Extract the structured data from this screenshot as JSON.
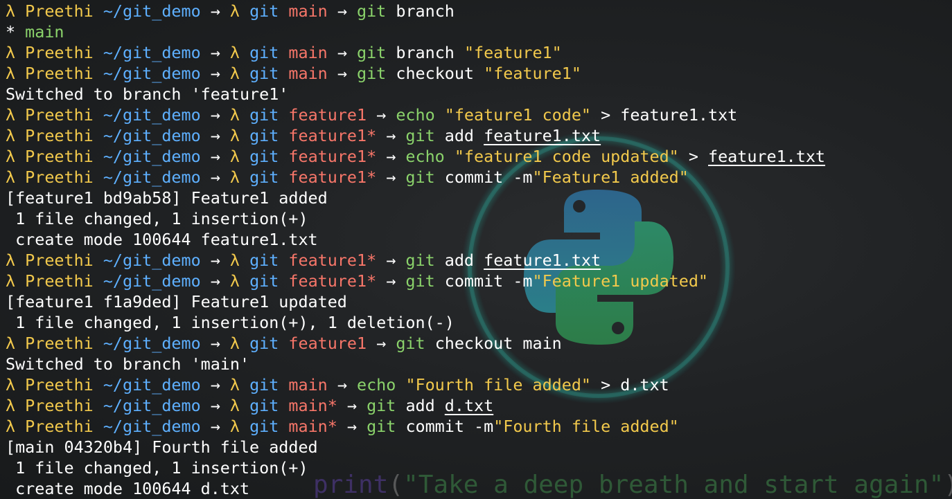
{
  "colors": {
    "prompt_lambda": "#f2c94c",
    "path": "#5eb0ff",
    "branch": "#f77669",
    "command": "#8bd36b",
    "string": "#f2c94c",
    "output": "#ffffff"
  },
  "background": {
    "logo_icon": "python-logo-icon",
    "quote": [
      {
        "t": "print",
        "c": "#5a3f9e"
      },
      {
        "t": "(",
        "c": "#888888"
      },
      {
        "t": "\"Take a deep breath and start again\"",
        "c": "#3f8a4a"
      },
      {
        "t": ")",
        "c": "#888888"
      }
    ]
  },
  "lines": [
    [
      {
        "t": "λ Preethi ",
        "c": "yellow"
      },
      {
        "t": "~/git_demo",
        "c": "blue"
      },
      {
        "t": " → ",
        "c": "white"
      },
      {
        "t": "λ ",
        "c": "yellow"
      },
      {
        "t": "git ",
        "c": "blue"
      },
      {
        "t": "main",
        "c": "red"
      },
      {
        "t": " → ",
        "c": "white"
      },
      {
        "t": "git ",
        "c": "green"
      },
      {
        "t": "branch",
        "c": "white"
      }
    ],
    [
      {
        "t": "* ",
        "c": "white"
      },
      {
        "t": "main",
        "c": "green"
      }
    ],
    [
      {
        "t": "λ Preethi ",
        "c": "yellow"
      },
      {
        "t": "~/git_demo",
        "c": "blue"
      },
      {
        "t": " → ",
        "c": "white"
      },
      {
        "t": "λ ",
        "c": "yellow"
      },
      {
        "t": "git ",
        "c": "blue"
      },
      {
        "t": "main",
        "c": "red"
      },
      {
        "t": " → ",
        "c": "white"
      },
      {
        "t": "git ",
        "c": "green"
      },
      {
        "t": "branch ",
        "c": "white"
      },
      {
        "t": "\"feature1\"",
        "c": "str"
      }
    ],
    [
      {
        "t": "λ Preethi ",
        "c": "yellow"
      },
      {
        "t": "~/git_demo",
        "c": "blue"
      },
      {
        "t": " → ",
        "c": "white"
      },
      {
        "t": "λ ",
        "c": "yellow"
      },
      {
        "t": "git ",
        "c": "blue"
      },
      {
        "t": "main",
        "c": "red"
      },
      {
        "t": " → ",
        "c": "white"
      },
      {
        "t": "git ",
        "c": "green"
      },
      {
        "t": "checkout ",
        "c": "white"
      },
      {
        "t": "\"feature1\"",
        "c": "str"
      }
    ],
    [
      {
        "t": "Switched to branch 'feature1'",
        "c": "white"
      }
    ],
    [
      {
        "t": "λ Preethi ",
        "c": "yellow"
      },
      {
        "t": "~/git_demo",
        "c": "blue"
      },
      {
        "t": " → ",
        "c": "white"
      },
      {
        "t": "λ ",
        "c": "yellow"
      },
      {
        "t": "git ",
        "c": "blue"
      },
      {
        "t": "feature1",
        "c": "red"
      },
      {
        "t": " → ",
        "c": "white"
      },
      {
        "t": "echo ",
        "c": "green"
      },
      {
        "t": "\"feature1 code\"",
        "c": "str"
      },
      {
        "t": " > feature1.txt",
        "c": "white"
      }
    ],
    [
      {
        "t": "λ Preethi ",
        "c": "yellow"
      },
      {
        "t": "~/git_demo",
        "c": "blue"
      },
      {
        "t": " → ",
        "c": "white"
      },
      {
        "t": "λ ",
        "c": "yellow"
      },
      {
        "t": "git ",
        "c": "blue"
      },
      {
        "t": "feature1*",
        "c": "red"
      },
      {
        "t": " → ",
        "c": "white"
      },
      {
        "t": "git ",
        "c": "green"
      },
      {
        "t": "add ",
        "c": "white"
      },
      {
        "t": "feature1.txt",
        "c": "white",
        "u": true
      }
    ],
    [
      {
        "t": "λ Preethi ",
        "c": "yellow"
      },
      {
        "t": "~/git_demo",
        "c": "blue"
      },
      {
        "t": " → ",
        "c": "white"
      },
      {
        "t": "λ ",
        "c": "yellow"
      },
      {
        "t": "git ",
        "c": "blue"
      },
      {
        "t": "feature1*",
        "c": "red"
      },
      {
        "t": " → ",
        "c": "white"
      },
      {
        "t": "echo ",
        "c": "green"
      },
      {
        "t": "\"feature1 code updated\"",
        "c": "str"
      },
      {
        "t": " > ",
        "c": "white"
      },
      {
        "t": "feature1.txt",
        "c": "white",
        "u": true
      }
    ],
    [
      {
        "t": "λ Preethi ",
        "c": "yellow"
      },
      {
        "t": "~/git_demo",
        "c": "blue"
      },
      {
        "t": " → ",
        "c": "white"
      },
      {
        "t": "λ ",
        "c": "yellow"
      },
      {
        "t": "git ",
        "c": "blue"
      },
      {
        "t": "feature1*",
        "c": "red"
      },
      {
        "t": " → ",
        "c": "white"
      },
      {
        "t": "git ",
        "c": "green"
      },
      {
        "t": "commit -m",
        "c": "white"
      },
      {
        "t": "\"Feature1 added\"",
        "c": "str"
      }
    ],
    [
      {
        "t": "[feature1 bd9ab58] Feature1 added",
        "c": "white"
      }
    ],
    [
      {
        "t": " 1 file changed, 1 insertion(+)",
        "c": "white"
      }
    ],
    [
      {
        "t": " create mode 100644 feature1.txt",
        "c": "white"
      }
    ],
    [
      {
        "t": "λ Preethi ",
        "c": "yellow"
      },
      {
        "t": "~/git_demo",
        "c": "blue"
      },
      {
        "t": " → ",
        "c": "white"
      },
      {
        "t": "λ ",
        "c": "yellow"
      },
      {
        "t": "git ",
        "c": "blue"
      },
      {
        "t": "feature1*",
        "c": "red"
      },
      {
        "t": " → ",
        "c": "white"
      },
      {
        "t": "git ",
        "c": "green"
      },
      {
        "t": "add ",
        "c": "white"
      },
      {
        "t": "feature1.txt",
        "c": "white",
        "u": true
      }
    ],
    [
      {
        "t": "λ Preethi ",
        "c": "yellow"
      },
      {
        "t": "~/git_demo",
        "c": "blue"
      },
      {
        "t": " → ",
        "c": "white"
      },
      {
        "t": "λ ",
        "c": "yellow"
      },
      {
        "t": "git ",
        "c": "blue"
      },
      {
        "t": "feature1*",
        "c": "red"
      },
      {
        "t": " → ",
        "c": "white"
      },
      {
        "t": "git ",
        "c": "green"
      },
      {
        "t": "commit -m",
        "c": "white"
      },
      {
        "t": "\"Feature1 updated\"",
        "c": "str"
      }
    ],
    [
      {
        "t": "[feature1 f1a9ded] Feature1 updated",
        "c": "white"
      }
    ],
    [
      {
        "t": " 1 file changed, 1 insertion(+), 1 deletion(-)",
        "c": "white"
      }
    ],
    [
      {
        "t": "λ Preethi ",
        "c": "yellow"
      },
      {
        "t": "~/git_demo",
        "c": "blue"
      },
      {
        "t": " → ",
        "c": "white"
      },
      {
        "t": "λ ",
        "c": "yellow"
      },
      {
        "t": "git ",
        "c": "blue"
      },
      {
        "t": "feature1",
        "c": "red"
      },
      {
        "t": " → ",
        "c": "white"
      },
      {
        "t": "git ",
        "c": "green"
      },
      {
        "t": "checkout main",
        "c": "white"
      }
    ],
    [
      {
        "t": "Switched to branch 'main'",
        "c": "white"
      }
    ],
    [
      {
        "t": "λ Preethi ",
        "c": "yellow"
      },
      {
        "t": "~/git_demo",
        "c": "blue"
      },
      {
        "t": " → ",
        "c": "white"
      },
      {
        "t": "λ ",
        "c": "yellow"
      },
      {
        "t": "git ",
        "c": "blue"
      },
      {
        "t": "main",
        "c": "red"
      },
      {
        "t": " → ",
        "c": "white"
      },
      {
        "t": "echo ",
        "c": "green"
      },
      {
        "t": "\"Fourth file added\"",
        "c": "str"
      },
      {
        "t": " > d.txt",
        "c": "white"
      }
    ],
    [
      {
        "t": "λ Preethi ",
        "c": "yellow"
      },
      {
        "t": "~/git_demo",
        "c": "blue"
      },
      {
        "t": " → ",
        "c": "white"
      },
      {
        "t": "λ ",
        "c": "yellow"
      },
      {
        "t": "git ",
        "c": "blue"
      },
      {
        "t": "main*",
        "c": "red"
      },
      {
        "t": " → ",
        "c": "white"
      },
      {
        "t": "git ",
        "c": "green"
      },
      {
        "t": "add ",
        "c": "white"
      },
      {
        "t": "d.txt",
        "c": "white",
        "u": true
      }
    ],
    [
      {
        "t": "λ Preethi ",
        "c": "yellow"
      },
      {
        "t": "~/git_demo",
        "c": "blue"
      },
      {
        "t": " → ",
        "c": "white"
      },
      {
        "t": "λ ",
        "c": "yellow"
      },
      {
        "t": "git ",
        "c": "blue"
      },
      {
        "t": "main*",
        "c": "red"
      },
      {
        "t": " → ",
        "c": "white"
      },
      {
        "t": "git ",
        "c": "green"
      },
      {
        "t": "commit -m",
        "c": "white"
      },
      {
        "t": "\"Fourth file added\"",
        "c": "str"
      }
    ],
    [
      {
        "t": "[main 04320b4] Fourth file added",
        "c": "white"
      }
    ],
    [
      {
        "t": " 1 file changed, 1 insertion(+)",
        "c": "white"
      }
    ],
    [
      {
        "t": " create mode 100644 d.txt",
        "c": "white"
      }
    ]
  ]
}
